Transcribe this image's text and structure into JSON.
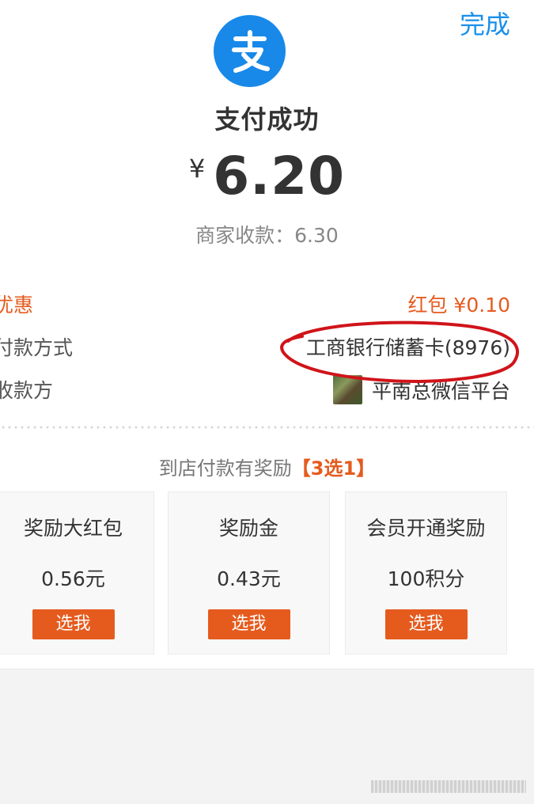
{
  "header": {
    "done_label": "完成"
  },
  "logo": {
    "glyph": "支"
  },
  "status": {
    "title": "支付成功"
  },
  "amount": {
    "currency": "¥",
    "value": "6.20"
  },
  "merchant": {
    "received": "商家收款：6.30"
  },
  "details": {
    "discount_label": "优惠",
    "discount_value": "红包  ¥0.10",
    "method_label": "付款方式",
    "method_value": "工商银行储蓄卡(8976)",
    "payee_label": "收款方",
    "payee_value": "平南总微信平台"
  },
  "rewards": {
    "heading": "到店付款有奖励",
    "heading_highlight": "【3选1】",
    "items": [
      {
        "name": "奖励大红包",
        "value": "0.56元",
        "button": "选我"
      },
      {
        "name": "奖励金",
        "value": "0.43元",
        "button": "选我"
      },
      {
        "name": "会员开通奖励",
        "value": "100积分",
        "button": "选我"
      }
    ]
  },
  "colors": {
    "accent_blue": "#1889e8",
    "accent_orange": "#e55b1e",
    "annotation_red": "#d0141a"
  }
}
